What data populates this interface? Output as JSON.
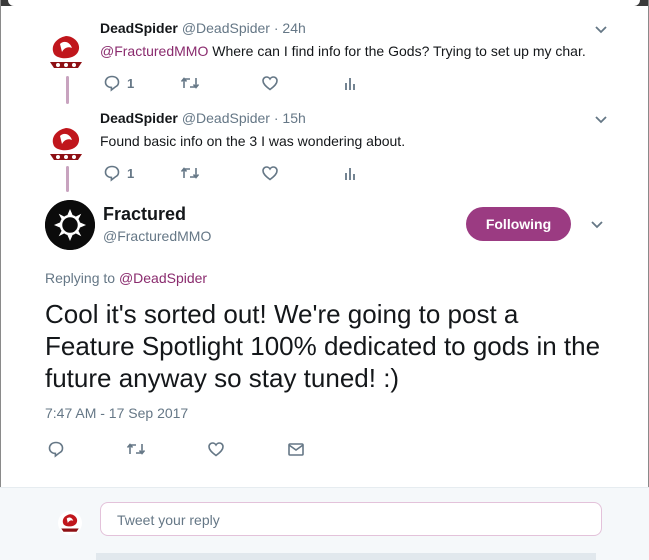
{
  "colors": {
    "accent": "#9b3b82",
    "mention": "#8a2b6e",
    "muted": "#657786",
    "text": "#14171a"
  },
  "thread": [
    {
      "name": "DeadSpider",
      "handle": "@DeadSpider",
      "time": "· 24h",
      "mention": "@FracturedMMO",
      "text": " Where can I find info for the Gods? Trying to set up my char.",
      "reply_count": "1"
    },
    {
      "name": "DeadSpider",
      "handle": "@DeadSpider",
      "time": "· 15h",
      "mention": "",
      "text": "Found basic info on the 3 I was wondering about.",
      "reply_count": "1"
    }
  ],
  "main_tweet": {
    "name": "Fractured",
    "handle": "@FracturedMMO",
    "follow_label": "Following",
    "replying_prefix": "Replying to",
    "replying_to": "@DeadSpider",
    "text": "Cool it's sorted out! We're going to post a Feature Spotlight 100% dedicated to gods in the future anyway so stay tuned! :)",
    "timestamp": "7:47 AM - 17 Sep 2017"
  },
  "reply_box": {
    "placeholder": "Tweet your reply"
  },
  "icons": {
    "reply": "reply-icon",
    "retweet": "retweet-icon",
    "like": "heart-icon",
    "analytics": "analytics-icon",
    "dm": "envelope-icon",
    "more": "chevron-down-icon"
  }
}
